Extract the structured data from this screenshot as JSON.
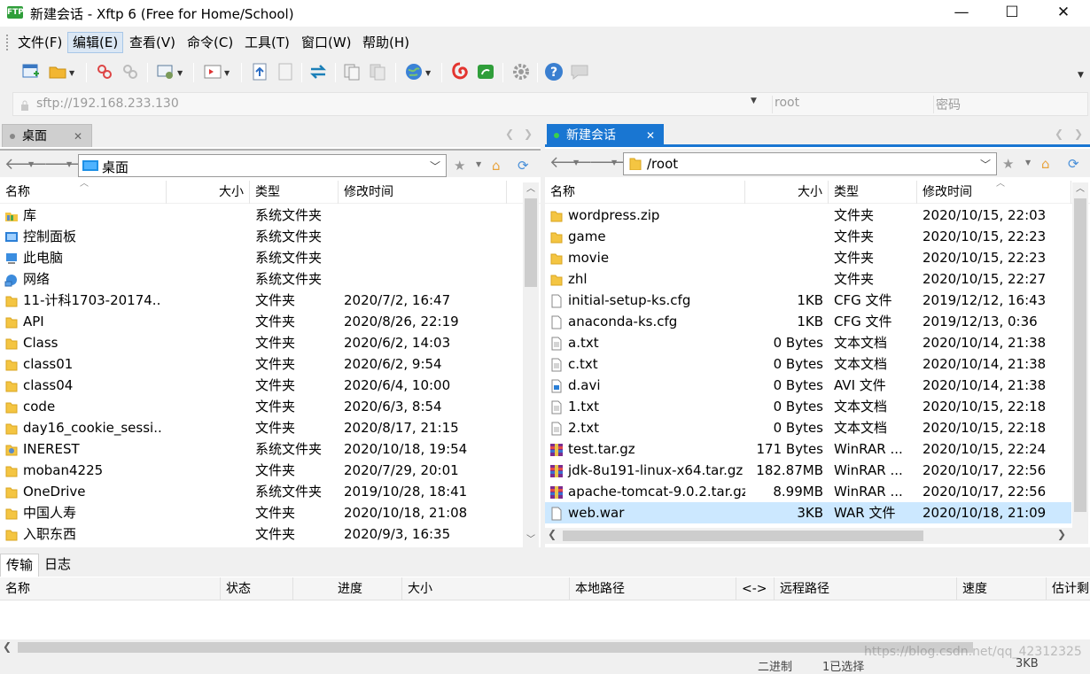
{
  "window": {
    "title": "新建会话 - Xftp 6 (Free for Home/School)",
    "minimize_glyph": "—",
    "maximize_glyph": "☐",
    "close_glyph": "✕"
  },
  "menu": [
    "文件(F)",
    "编辑(E)",
    "查看(V)",
    "命令(C)",
    "工具(T)",
    "窗口(W)",
    "帮助(H)"
  ],
  "address": {
    "url": "sftp://192.168.233.130",
    "user_placeholder": "root",
    "password_placeholder": "密码"
  },
  "left": {
    "tab_label": "桌面",
    "path": "桌面",
    "headers": {
      "name": "名称",
      "size": "大小",
      "type": "类型",
      "mtime": "修改时间"
    },
    "files": [
      {
        "name": "库",
        "size": "",
        "type": "系统文件夹",
        "mtime": "",
        "icon": "library-icon"
      },
      {
        "name": "控制面板",
        "size": "",
        "type": "系统文件夹",
        "mtime": "",
        "icon": "control-panel-icon"
      },
      {
        "name": "此电脑",
        "size": "",
        "type": "系统文件夹",
        "mtime": "",
        "icon": "computer-icon"
      },
      {
        "name": "网络",
        "size": "",
        "type": "系统文件夹",
        "mtime": "",
        "icon": "network-icon"
      },
      {
        "name": "11-计科1703-20174...",
        "size": "",
        "type": "文件夹",
        "mtime": "2020/7/2, 16:47",
        "icon": "folder-icon"
      },
      {
        "name": "API",
        "size": "",
        "type": "文件夹",
        "mtime": "2020/8/26, 22:19",
        "icon": "folder-icon"
      },
      {
        "name": "Class",
        "size": "",
        "type": "文件夹",
        "mtime": "2020/6/2, 14:03",
        "icon": "folder-icon"
      },
      {
        "name": "class01",
        "size": "",
        "type": "文件夹",
        "mtime": "2020/6/2, 9:54",
        "icon": "folder-icon"
      },
      {
        "name": "class04",
        "size": "",
        "type": "文件夹",
        "mtime": "2020/6/4, 10:00",
        "icon": "folder-icon"
      },
      {
        "name": "code",
        "size": "",
        "type": "文件夹",
        "mtime": "2020/6/3, 8:54",
        "icon": "folder-icon"
      },
      {
        "name": "day16_cookie_sessi...",
        "size": "",
        "type": "文件夹",
        "mtime": "2020/8/17, 21:15",
        "icon": "folder-icon"
      },
      {
        "name": "INEREST",
        "size": "",
        "type": "系统文件夹",
        "mtime": "2020/10/18, 19:54",
        "icon": "user-folder-icon"
      },
      {
        "name": "moban4225",
        "size": "",
        "type": "文件夹",
        "mtime": "2020/7/29, 20:01",
        "icon": "folder-icon"
      },
      {
        "name": "OneDrive",
        "size": "",
        "type": "系统文件夹",
        "mtime": "2019/10/28, 18:41",
        "icon": "folder-icon"
      },
      {
        "name": "中国人寿",
        "size": "",
        "type": "文件夹",
        "mtime": "2020/10/18, 21:08",
        "icon": "folder-icon"
      },
      {
        "name": "入职东西",
        "size": "",
        "type": "文件夹",
        "mtime": "2020/9/3, 16:35",
        "icon": "folder-icon"
      }
    ]
  },
  "right": {
    "tab_label": "新建会话",
    "path": "/root",
    "headers": {
      "name": "名称",
      "size": "大小",
      "type": "类型",
      "mtime": "修改时间"
    },
    "files": [
      {
        "name": "wordpress.zip",
        "size": "",
        "type": "文件夹",
        "mtime": "2020/10/15, 22:03",
        "icon": "folder-icon"
      },
      {
        "name": "game",
        "size": "",
        "type": "文件夹",
        "mtime": "2020/10/15, 22:23",
        "icon": "folder-icon"
      },
      {
        "name": "movie",
        "size": "",
        "type": "文件夹",
        "mtime": "2020/10/15, 22:23",
        "icon": "folder-icon"
      },
      {
        "name": "zhl",
        "size": "",
        "type": "文件夹",
        "mtime": "2020/10/15, 22:27",
        "icon": "folder-icon"
      },
      {
        "name": "initial-setup-ks.cfg",
        "size": "1KB",
        "type": "CFG 文件",
        "mtime": "2019/12/12, 16:43",
        "icon": "file-icon"
      },
      {
        "name": "anaconda-ks.cfg",
        "size": "1KB",
        "type": "CFG 文件",
        "mtime": "2019/12/13, 0:36",
        "icon": "file-icon"
      },
      {
        "name": "a.txt",
        "size": "0 Bytes",
        "type": "文本文档",
        "mtime": "2020/10/14, 21:38",
        "icon": "text-file-icon"
      },
      {
        "name": "c.txt",
        "size": "0 Bytes",
        "type": "文本文档",
        "mtime": "2020/10/14, 21:38",
        "icon": "text-file-icon"
      },
      {
        "name": "d.avi",
        "size": "0 Bytes",
        "type": "AVI 文件",
        "mtime": "2020/10/14, 21:38",
        "icon": "video-file-icon"
      },
      {
        "name": "1.txt",
        "size": "0 Bytes",
        "type": "文本文档",
        "mtime": "2020/10/15, 22:18",
        "icon": "text-file-icon"
      },
      {
        "name": "2.txt",
        "size": "0 Bytes",
        "type": "文本文档",
        "mtime": "2020/10/15, 22:18",
        "icon": "text-file-icon"
      },
      {
        "name": "test.tar.gz",
        "size": "171 Bytes",
        "type": "WinRAR ...",
        "mtime": "2020/10/15, 22:24",
        "icon": "archive-icon"
      },
      {
        "name": "jdk-8u191-linux-x64.tar.gz",
        "size": "182.87MB",
        "type": "WinRAR ...",
        "mtime": "2020/10/17, 22:56",
        "icon": "archive-icon"
      },
      {
        "name": "apache-tomcat-9.0.2.tar.gz",
        "size": "8.99MB",
        "type": "WinRAR ...",
        "mtime": "2020/10/17, 22:56",
        "icon": "archive-icon"
      },
      {
        "name": "web.war",
        "size": "3KB",
        "type": "WAR 文件",
        "mtime": "2020/10/18, 21:09",
        "icon": "file-icon",
        "selected": true
      }
    ]
  },
  "transfer": {
    "tabs": [
      "传输",
      "日志"
    ],
    "headers": [
      "名称",
      "状态",
      "进度",
      "大小",
      "本地路径",
      "<->",
      "远程路径",
      "速度",
      "估计剩"
    ]
  },
  "status": {
    "mode": "二进制",
    "selection": "1已选择",
    "size": "3KB",
    "watermark": "https://blog.csdn.net/qq_42312325"
  },
  "colors": {
    "accent": "#1a73d9",
    "selection": "#cce8ff",
    "folder": "#f4c542",
    "active_tab": "#1976d2"
  }
}
